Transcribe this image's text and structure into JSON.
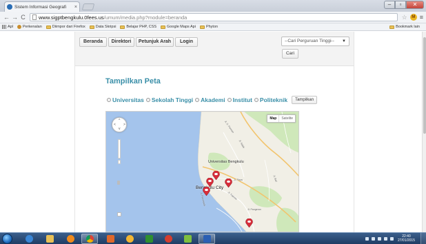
{
  "browser": {
    "tab_title": "Sistem Informasi Geografi",
    "tab_close": "×",
    "url_host": "www.sigptbengkulu.0fees.us",
    "url_path": "/umum/media.php?module=beranda",
    "bookmarks": [
      "Apl",
      "Perkenalan",
      "Diimpor dari Firefox",
      "Data Skripsi",
      "Belajar PHP, CSS",
      "Google Maps Api",
      "Phyton"
    ],
    "bookmarks_other": "Bookmark lain"
  },
  "page": {
    "nav": [
      "Beranda",
      "Direktori",
      "Petunjuk Arah",
      "Login"
    ],
    "search_select": "--Cari Perguruan Tinggi--",
    "search_button": "Cari",
    "heading": "Tampilkan Peta",
    "filters": [
      "Universitas",
      "Sekolah Tinggi",
      "Akademi",
      "Institut",
      "Politeknik"
    ],
    "show_button": "Tampilkan"
  },
  "map": {
    "type_map": "Map",
    "type_satellite": "Satelite",
    "label_university": "Universitas Bengkulu",
    "label_city": "Bengkulu City",
    "label_road_1": "Jl. Raya",
    "label_road_2": "Jl. Salak",
    "label_road_3": "Jl. S. Parman",
    "label_road_4": "Jl. Pariwisata",
    "label_road_5": "Jl. Kapuas",
    "label_road_6": "Jl. Pangeran",
    "label_road_7": "Jl. Bali",
    "marker_count": 5
  },
  "taskbar": {
    "time": "22:40",
    "date": "27/01/2015"
  },
  "colors": {
    "heading": "#3a8fa8",
    "water": "#a4c4ec",
    "land": "#f1efe6",
    "green": "#cfe8ba",
    "marker": "#d62d3a"
  }
}
